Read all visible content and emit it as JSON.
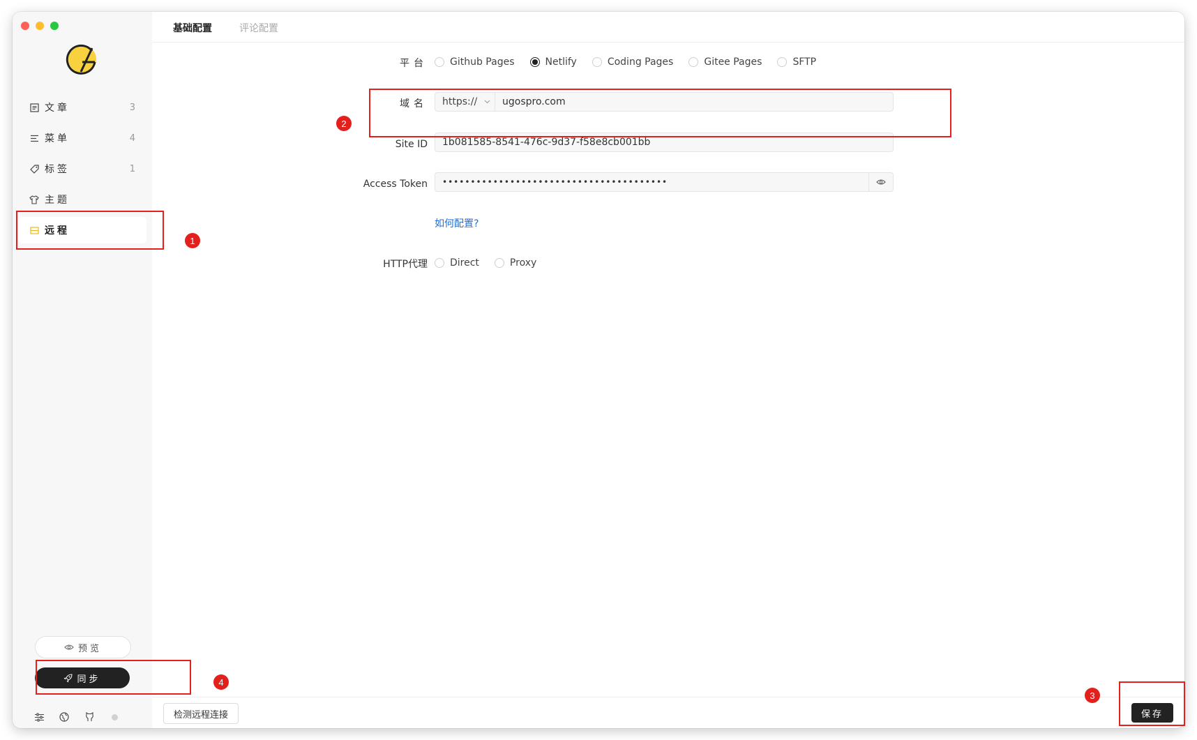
{
  "sidebar": {
    "items": [
      {
        "label": "文章",
        "count": "3",
        "icon": "article-icon"
      },
      {
        "label": "菜单",
        "count": "4",
        "icon": "menu-icon"
      },
      {
        "label": "标签",
        "count": "1",
        "icon": "tag-icon"
      },
      {
        "label": "主题",
        "count": "",
        "icon": "theme-shirt-icon"
      },
      {
        "label": "远程",
        "count": "",
        "icon": "remote-icon",
        "active": true
      }
    ],
    "preview_label": "预览",
    "sync_label": "同步"
  },
  "tabs": {
    "basic": "基础配置",
    "comment": "评论配置"
  },
  "form": {
    "platform": {
      "label": "平台",
      "options": [
        "Github Pages",
        "Netlify",
        "Coding Pages",
        "Gitee Pages",
        "SFTP"
      ],
      "selected": "Netlify"
    },
    "domain": {
      "label": "域名",
      "protocol": "https://",
      "value": "ugospro.com"
    },
    "site_id": {
      "label": "Site ID",
      "value": "1b081585-8541-476c-9d37-f58e8cb001bb"
    },
    "access_token": {
      "label": "Access Token",
      "value": "••••••••••••••••••••••••••••••••••••••••"
    },
    "help_link": "如何配置?",
    "http_proxy": {
      "label": "HTTP代理",
      "options": [
        "Direct",
        "Proxy"
      ],
      "selected": ""
    }
  },
  "footer": {
    "check_label": "检测远程连接",
    "save_label": "保存"
  },
  "annotations": [
    "1",
    "2",
    "3",
    "4"
  ],
  "colors": {
    "accent": "#222222",
    "logo_yellow": "#f7d23e",
    "annotation_red": "#e3201c",
    "link_blue": "#1f6fd6"
  }
}
